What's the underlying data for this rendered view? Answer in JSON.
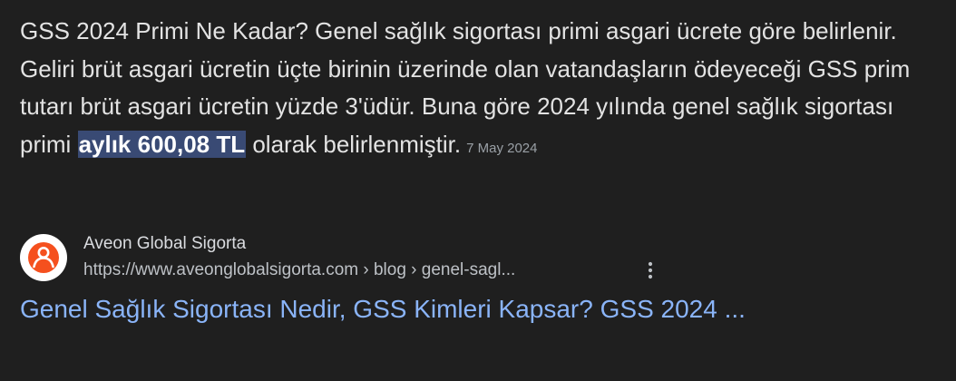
{
  "snippet": {
    "text_before": "GSS 2024 Primi Ne Kadar? Genel sağlık sigortası primi asgari ücrete göre belirlenir. Geliri brüt asgari ücretin üçte birinin üzerinde olan vatandaşların ödeyeceği GSS prim tutarı brüt asgari ücretin yüzde 3'üdür. Buna göre 2024 yılında genel sağlık sigortası primi ",
    "highlight": "aylık 600,08 TL",
    "text_after": " olarak belirlenmiştir.",
    "date": "7 May 2024"
  },
  "source": {
    "site_name": "Aveon Global Sigorta",
    "url": "https://www.aveonglobalsigorta.com › blog › genel-sagl...",
    "favicon_icon": "aveon-logo-icon",
    "more_icon": "more-vert-icon"
  },
  "result": {
    "title": "Genel Sağlık Sigortası Nedir, GSS Kimleri Kapsar? GSS 2024 ..."
  },
  "colors": {
    "background": "#1f1f1f",
    "highlight_bg": "#394a74",
    "link": "#8ab4f8",
    "brand": "#f5501e"
  }
}
